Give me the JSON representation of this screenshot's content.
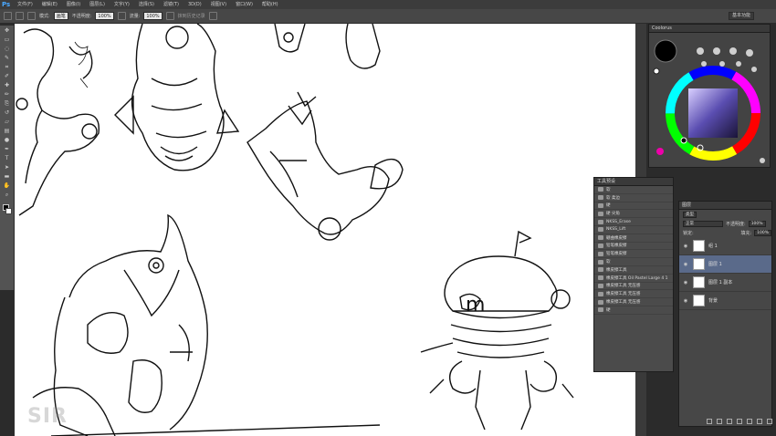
{
  "app": {
    "logo": "Ps"
  },
  "menu": [
    "文件(F)",
    "编辑(E)",
    "图像(I)",
    "图层(L)",
    "文字(Y)",
    "选择(S)",
    "滤镜(T)",
    "3D(D)",
    "视图(V)",
    "窗口(W)",
    "帮助(H)"
  ],
  "options": {
    "mode_label": "模式:",
    "mode_value": "画笔",
    "opacity_label": "不透明度:",
    "opacity_value": "100%",
    "flow_label": "流量:",
    "flow_value": "100%",
    "erase_history": "抹到历史记录",
    "workspace": "基本功能"
  },
  "color_panel": {
    "title": "Coolorus"
  },
  "brush_panel": {
    "title": "工具预设",
    "items": [
      "软",
      "软 柔边",
      "硬",
      "硬 尖角",
      "NKSS_Erase",
      "NKSS_Lift",
      "硼曲橡皮擦",
      "铅笔橡皮擦",
      "铅笔橡皮擦",
      "软",
      "橡皮擦工具",
      "橡皮擦工具 Oil Pastel Large 4 1",
      "橡皮擦工具 无压感",
      "橡皮擦工具 无压感",
      "橡皮擦工具 无压感",
      "硬"
    ]
  },
  "layers_panel": {
    "title": "图层",
    "kind_label": "类型",
    "blend_mode": "正常",
    "opacity_label": "不透明度:",
    "opacity_value": "100%",
    "lock_label": "锁定:",
    "fill_label": "填充:",
    "fill_value": "100%",
    "layers": [
      {
        "name": "组 1",
        "active": false
      },
      {
        "name": "图层 1",
        "active": true
      },
      {
        "name": "图层 1 副本",
        "active": false
      },
      {
        "name": "背景",
        "active": false
      }
    ]
  },
  "watermark": {
    "text": "SIR",
    "id": "6814418"
  }
}
